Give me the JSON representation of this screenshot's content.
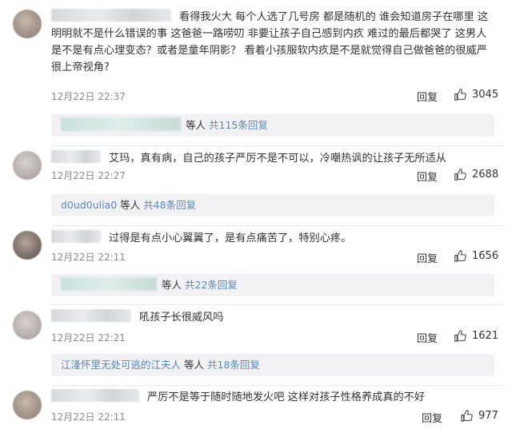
{
  "comments": [
    {
      "text": "看得我火大 每个人选了几号房 都是随机的 谁会知道房子在哪里 这明明就不是什么错误的事 这爸爸一路唠叨 非要让孩子自己感到内疚 难过的最后都哭了 这男人是不是有点心理变态？或者是童年阴影？ 看着小孩服软内疚是不是就觉得自己做爸爸的很威严很上帝视角?",
      "time": "12月22日 22:37",
      "reply_label": "回复",
      "likes": "3045",
      "sub_name": "",
      "sub_text": "等人",
      "sub_count": "共115条回复"
    },
    {
      "text": "艾玛，真有病，自己的孩子严厉不是不可以，冷嘲热讽的让孩子无所适从",
      "time": "12月22日 22:27",
      "reply_label": "回复",
      "likes": "2688",
      "sub_name": "d0ud0ulia0",
      "sub_text": "等人",
      "sub_count": "共48条回复"
    },
    {
      "text": "过得是有点小心翼翼了，是有点痛苦了，特别心疼。",
      "time": "12月22日 22:11",
      "reply_label": "回复",
      "likes": "1656",
      "sub_name": "",
      "sub_text": "等人",
      "sub_count": "共22条回复"
    },
    {
      "text": "吼孩子长很威风吗",
      "time": "12月22日 22:21",
      "reply_label": "回复",
      "likes": "1621",
      "sub_name": "江湰怀里无处可逃的江夫人",
      "sub_text": "等人",
      "sub_count": "共18条回复"
    },
    {
      "text": "严厉不是等于随时随地发火吧 这样对孩子性格养成真的不好",
      "time": "12月22日 22:11",
      "reply_label": "回复",
      "likes": "977"
    }
  ]
}
